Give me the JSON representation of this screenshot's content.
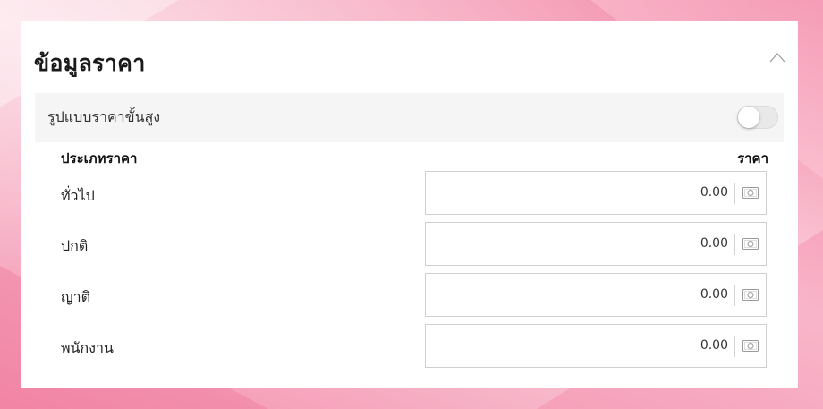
{
  "section": {
    "title": "ข้อมูลราคา",
    "advanced_label": "รูปแบบราคาขั้นสูง",
    "advanced_enabled": false
  },
  "table": {
    "col_type": "ประเภทราคา",
    "col_price": "ราคา",
    "rows": [
      {
        "label": "ทั่วไป",
        "price": "0.00"
      },
      {
        "label": "ปกติ",
        "price": "0.00"
      },
      {
        "label": "ญาติ",
        "price": "0.00"
      },
      {
        "label": "พนักงาน",
        "price": "0.00"
      }
    ]
  },
  "icons": {
    "collapse": "chevron-up-icon",
    "currency": "money-icon"
  },
  "colors": {
    "background": "#f48fae",
    "card": "#ffffff",
    "adv_row_bg": "#f5f5f5"
  }
}
